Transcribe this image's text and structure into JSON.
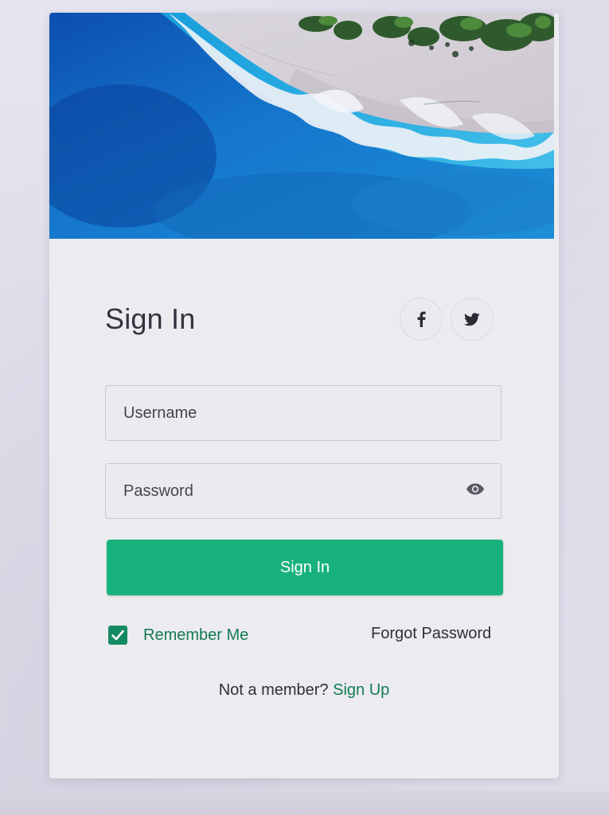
{
  "form": {
    "title": "Sign In",
    "username_placeholder": "Username",
    "password_placeholder": "Password",
    "submit_label": "Sign In",
    "remember_label": "Remember Me",
    "remember_checked": true,
    "forgot_label": "Forgot Password",
    "member_prompt": "Not a member?",
    "signup_label": "Sign Up"
  },
  "social": [
    {
      "name": "facebook",
      "icon": "facebook-icon",
      "glyph": "f"
    },
    {
      "name": "twitter",
      "icon": "twitter-icon"
    }
  ],
  "hero": {
    "icon": "beach-aerial-image"
  },
  "colors": {
    "accent": "#17b27c",
    "link": "#137a57",
    "text": "#333340",
    "card": "#ecebef"
  }
}
